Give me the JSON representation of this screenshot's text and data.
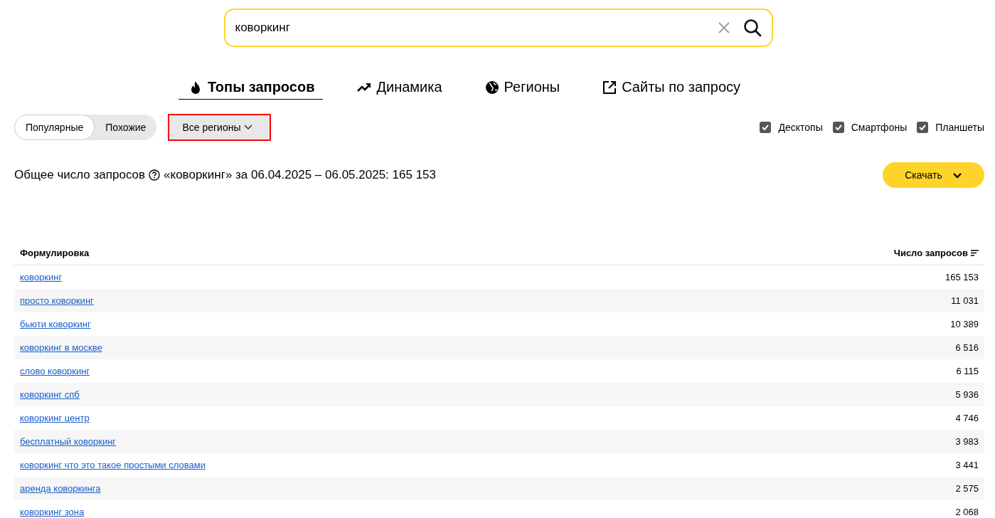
{
  "search": {
    "value": "коворкинг"
  },
  "tabs": [
    {
      "label": "Топы запросов",
      "kind": "flame",
      "selected": true
    },
    {
      "label": "Динамика",
      "kind": "trend",
      "selected": false
    },
    {
      "label": "Регионы",
      "kind": "globe",
      "selected": false
    },
    {
      "label": "Сайты по запросу",
      "kind": "external",
      "selected": false
    }
  ],
  "mode_switch": [
    {
      "label": "Популярные",
      "selected": true
    },
    {
      "label": "Похожие",
      "selected": false
    }
  ],
  "region_dropdown": {
    "label": "Все регионы",
    "highlighted": true
  },
  "devices": [
    {
      "label": "Десктопы",
      "checked": true
    },
    {
      "label": "Смартфоны",
      "checked": true
    },
    {
      "label": "Планшеты",
      "checked": true
    }
  ],
  "summary": {
    "label": "Общее число запросов",
    "text": "«коворкинг» за 06.04.2025 – 06.05.2025: 165 153"
  },
  "download_button": {
    "label": "Скачать"
  },
  "table": {
    "columns": [
      "Формулировка",
      "Число запросов"
    ],
    "rows": [
      [
        "коворкинг",
        "165 153"
      ],
      [
        "просто коворкинг",
        "11 031"
      ],
      [
        "бьюти коворкинг",
        "10 389"
      ],
      [
        "коворкинг в москве",
        "6 516"
      ],
      [
        "слово коворкинг",
        "6 115"
      ],
      [
        "коворкинг спб",
        "5 936"
      ],
      [
        "коворкинг центр",
        "4 746"
      ],
      [
        "бесплатный коворкинг",
        "3 983"
      ],
      [
        "коворкинг что это такое простыми словами",
        "3 441"
      ],
      [
        "аренда коворкинга",
        "2 575"
      ],
      [
        "коворкинг зона",
        "2 068"
      ]
    ]
  }
}
